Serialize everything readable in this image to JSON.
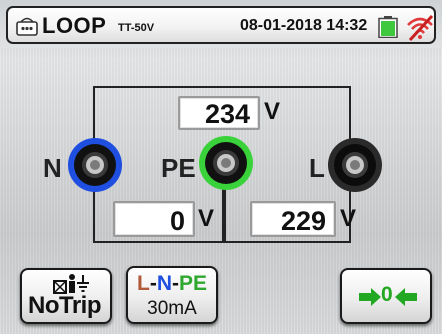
{
  "header": {
    "function_icon": "loop-test-icon",
    "title": "LOOP",
    "subtitle": "TT-50V",
    "datetime": "08-01-2018 14:32",
    "battery_icon": "battery-icon",
    "signal_icon": "no-signal-icon",
    "signal_color": "#e03a3a",
    "battery_color": "#3ec83e"
  },
  "terminals": {
    "n": {
      "label": "N",
      "ring_color": "#1f4fe0"
    },
    "pe": {
      "label": "PE",
      "ring_color": "#3ad23a"
    },
    "l": {
      "label": "L",
      "ring_color": "#2a2a2a"
    }
  },
  "measurements": {
    "l_n": {
      "value": "234",
      "unit": "V"
    },
    "n_pe": {
      "value": "0",
      "unit": "V"
    },
    "l_pe": {
      "value": "229",
      "unit": "V"
    }
  },
  "toolbar": {
    "notrip": {
      "icon": "ground-notrip-icon",
      "label": "NoTrip"
    },
    "rcd": {
      "label_l": "L",
      "label_n": "N",
      "label_pe": "PE",
      "dash": "-",
      "current": "30mA"
    },
    "zero": {
      "icon": "zero-calibration-icon",
      "label": "0"
    }
  }
}
